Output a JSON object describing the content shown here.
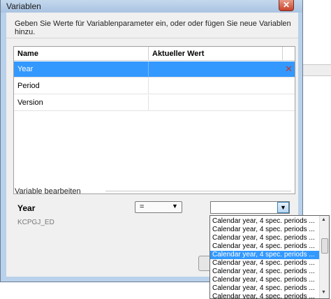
{
  "window": {
    "title": "Variablen",
    "close_glyph": "✕"
  },
  "instruction": "Geben Sie Werte für Variablenparameter ein, oder oder fügen Sie neue Variablen hinzu.",
  "grid": {
    "columns": [
      "Name",
      "Aktueller Wert"
    ],
    "rows": [
      {
        "name": "Year",
        "value": "",
        "selected": true
      },
      {
        "name": "Period",
        "value": ""
      },
      {
        "name": "Version",
        "value": ""
      }
    ],
    "delete_glyph": "✕"
  },
  "edit": {
    "section_label": "Variable bearbeiten",
    "variable_name": "Year",
    "technical_name": "KCPGJ_ED",
    "operator": "=",
    "value": ""
  },
  "dropdown": {
    "items": [
      "Calendar year, 4 spec. periods ...",
      "Calendar year, 4 spec. periods ...",
      "Calendar year, 4 spec. periods ...",
      "Calendar year, 4 spec. periods ...",
      "Calendar year, 4 spec. periods ...",
      "Calendar year, 4 spec. periods ...",
      "Calendar year, 4 spec. periods ...",
      "Calendar year, 4 spec. periods ...",
      "Calendar year, 4 spec. periods ...",
      "Calendar year, 4 spec. periods ..."
    ],
    "selected_index": 4
  },
  "colors": {
    "accent": "#3399ff",
    "title_bar": "#b9d1ea",
    "close": "#c8432b"
  }
}
